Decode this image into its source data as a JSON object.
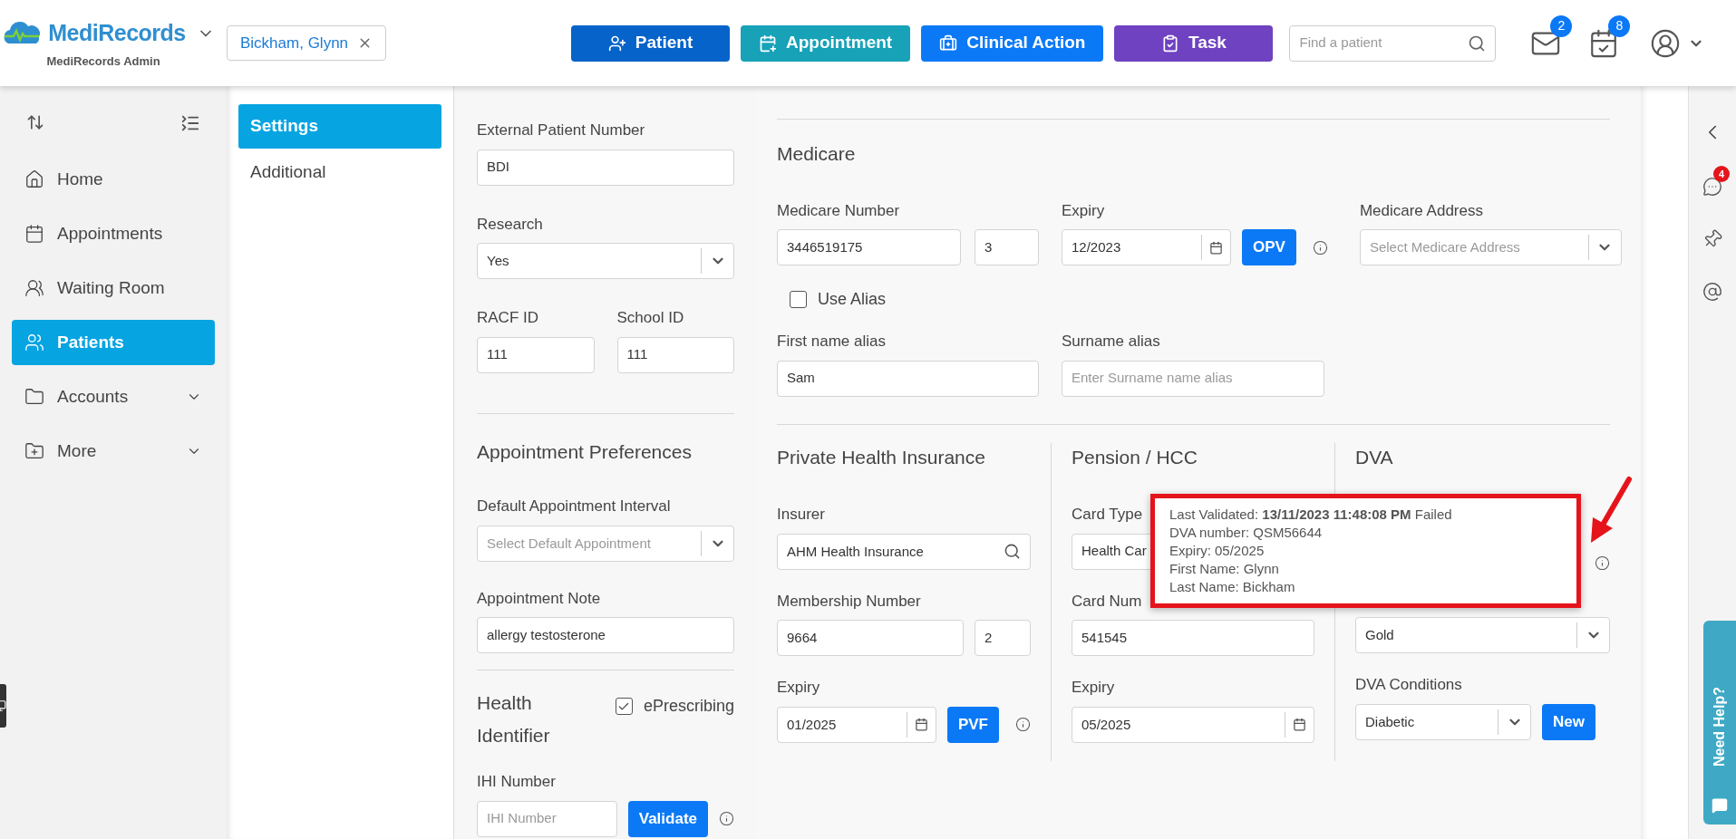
{
  "header": {
    "brand": "MediRecords",
    "subtitle": "MediRecords Admin",
    "patient_chip": "Bickham, Glynn",
    "actions": [
      {
        "label": "Patient",
        "color": "#0563c9"
      },
      {
        "label": "Appointment",
        "color": "#17a2b8"
      },
      {
        "label": "Clinical Action",
        "color": "#0b79f6"
      },
      {
        "label": "Task",
        "color": "#6f42c1"
      }
    ],
    "search": {
      "placeholder": "Find a patient"
    },
    "mail_badge": "2",
    "calendar_badge": "8"
  },
  "nav": {
    "items": [
      {
        "label": "Home",
        "selected": false,
        "expandable": false
      },
      {
        "label": "Appointments",
        "selected": false,
        "expandable": false
      },
      {
        "label": "Waiting Room",
        "selected": false,
        "expandable": false
      },
      {
        "label": "Patients",
        "selected": true,
        "expandable": false
      },
      {
        "label": "Accounts",
        "selected": false,
        "expandable": true
      },
      {
        "label": "More",
        "selected": false,
        "expandable": true
      }
    ]
  },
  "settings_nav": {
    "items": [
      {
        "label": "Settings",
        "selected": true
      },
      {
        "label": "Additional",
        "selected": false
      }
    ]
  },
  "left_form": {
    "external_patient_number": {
      "label": "External Patient Number",
      "kind": "text",
      "value": "BDI"
    },
    "research": {
      "label": "Research",
      "kind": "select",
      "value": "Yes"
    },
    "ids": [
      {
        "label": "RACF ID",
        "kind": "text",
        "value": "111"
      },
      {
        "label": "School ID",
        "kind": "text",
        "value": "111"
      }
    ],
    "appointment_preferences": {
      "title": "Appointment Preferences",
      "fields": [
        {
          "label": "Default Appointment Interval",
          "kind": "select",
          "placeholder": "Select Default Appointment"
        },
        {
          "label": "Appointment Note",
          "kind": "text",
          "value": "allergy testosterone"
        }
      ]
    },
    "health_identifier": {
      "title": "Health Identifier",
      "eprescribing": {
        "label": "ePrescribing",
        "checked": true
      },
      "ihi": {
        "label": "IHI Number",
        "kind": "text",
        "placeholder": "IHI Number"
      },
      "validate_button": "Validate"
    }
  },
  "medicare": {
    "title": "Medicare",
    "number": {
      "label": "Medicare Number",
      "kind": "text",
      "value": "3446519175"
    },
    "irn": {
      "kind": "text",
      "value": "3"
    },
    "expiry": {
      "label": "Expiry",
      "kind": "date",
      "value": "12/2023"
    },
    "opv_button": "OPV",
    "address": {
      "label": "Medicare Address",
      "kind": "select",
      "placeholder": "Select Medicare Address"
    },
    "use_alias": {
      "label": "Use Alias",
      "checked": false
    },
    "first_name_alias": {
      "label": "First name alias",
      "kind": "text",
      "value": "Sam"
    },
    "surname_alias": {
      "label": "Surname alias",
      "kind": "text",
      "placeholder": "Enter Surname name alias"
    }
  },
  "private_health_insurance": {
    "title": "Private Health Insurance",
    "insurer": {
      "label": "Insurer",
      "kind": "search",
      "value": "AHM Health Insurance"
    },
    "membership": {
      "label": "Membership Number",
      "kind": "text",
      "value": "9664"
    },
    "membership_suffix": {
      "kind": "text",
      "value": "2"
    },
    "expiry": {
      "label": "Expiry",
      "kind": "date",
      "value": "01/2025"
    },
    "pvf_button": "PVF"
  },
  "pension": {
    "title": "Pension / HCC",
    "card_type": {
      "label": "Card Type",
      "kind": "text",
      "value": "Health Car"
    },
    "card_number": {
      "label": "Card Num",
      "kind": "text",
      "value": "541545"
    },
    "expiry": {
      "label": "Expiry",
      "kind": "date",
      "value": "05/2025"
    }
  },
  "dva": {
    "title": "DVA",
    "card_type": {
      "kind": "select",
      "value": "Gold"
    },
    "conditions": {
      "label": "DVA Conditions",
      "kind": "select",
      "value": "Diabetic"
    },
    "new_button": "New"
  },
  "tooltip": {
    "lines": [
      "Last Validated: **13/11/2023 11:48:08 PM** Failed",
      "DVA number: QSM56644",
      "Expiry: 05/2025",
      "First Name: Glynn",
      "Last Name: Bickham"
    ]
  },
  "right_rail": {
    "chat_badge": "4"
  },
  "help_tab": "Need Help?"
}
